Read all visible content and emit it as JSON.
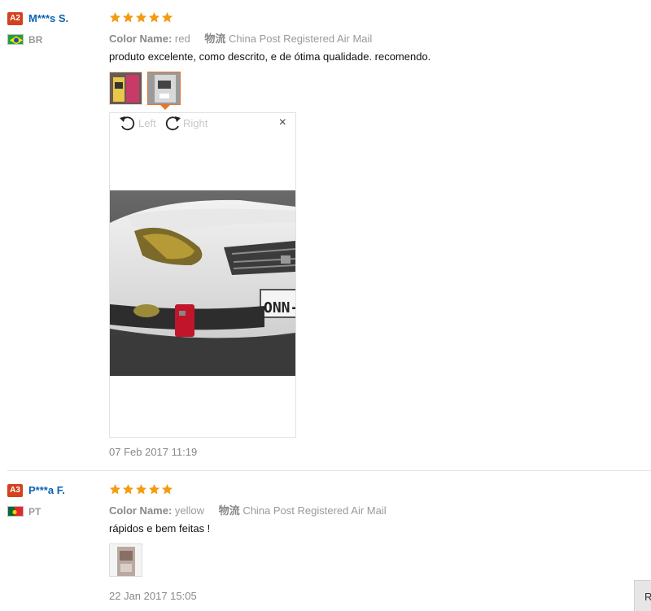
{
  "reviews": [
    {
      "level": "A2",
      "name": "M***s S.",
      "country": "BR",
      "rating": 5,
      "color_label": "Color Name:",
      "color_value": "red",
      "shipping_label": "物流",
      "shipping_value": "China Post Registered Air Mail",
      "text": "produto excelente, como descrito, e de ótima qualidade. recomendo.",
      "date": "07 Feb 2017 11:19",
      "viewer": {
        "rotate_left": "Left",
        "rotate_right": "Right",
        "close": "×",
        "plate_text": "ONN-"
      }
    },
    {
      "level": "A3",
      "name": "P***a F.",
      "country": "PT",
      "rating": 5,
      "color_label": "Color Name:",
      "color_value": "yellow",
      "shipping_label": "物流",
      "shipping_value": "China Post Registered Air Mail",
      "text": "rápidos e bem feitas !",
      "date": "22 Jan 2017 15:05"
    }
  ],
  "corner_button": "R",
  "colors": {
    "accent": "#e9752c",
    "star": "#f39c12",
    "badge": "#d3411f",
    "name": "#0b62b3"
  }
}
